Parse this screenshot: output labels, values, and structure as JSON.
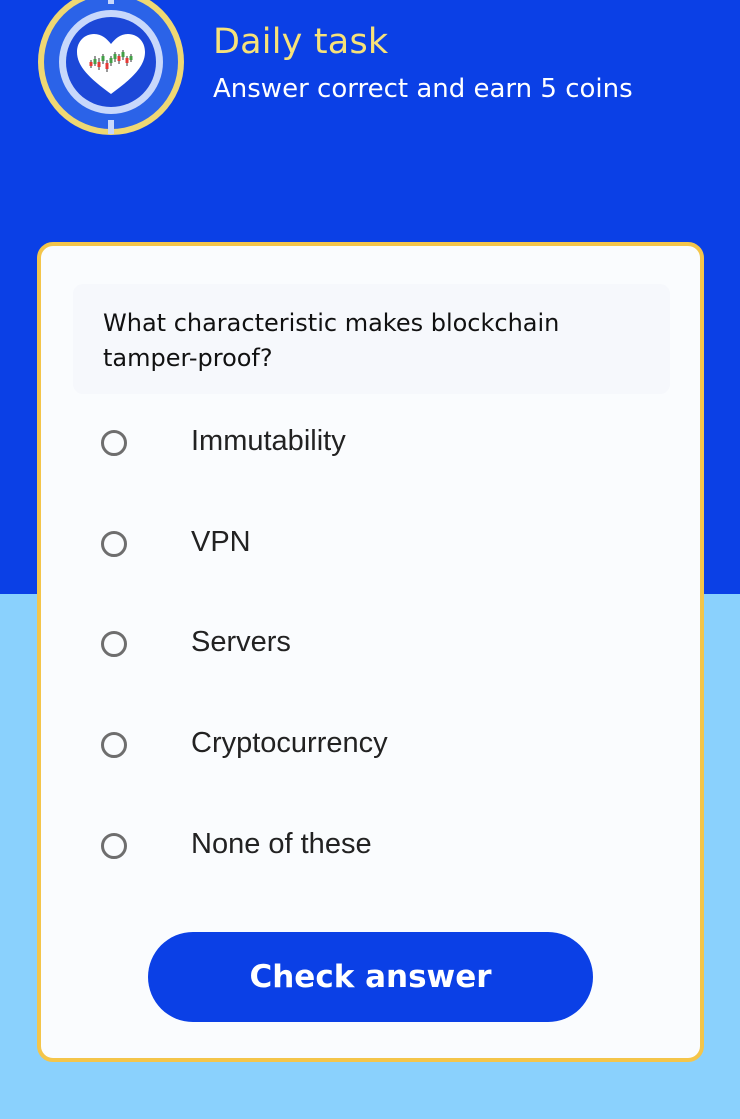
{
  "header": {
    "title": "Daily task",
    "subtitle": "Answer correct and earn 5 coins",
    "logo_icon": "heart-chart-coin-icon"
  },
  "quiz": {
    "question": "What characteristic makes blockchain tamper-proof?",
    "options": [
      {
        "label": "Immutability",
        "selected": false
      },
      {
        "label": "VPN",
        "selected": false
      },
      {
        "label": "Servers",
        "selected": false
      },
      {
        "label": "Cryptocurrency",
        "selected": false
      },
      {
        "label": "None of these",
        "selected": false
      }
    ],
    "submit_label": "Check answer"
  },
  "colors": {
    "primary_blue": "#0b40e6",
    "light_blue": "#8ad1fd",
    "accent_yellow": "#f4c54a",
    "title_yellow": "#f7e279"
  }
}
